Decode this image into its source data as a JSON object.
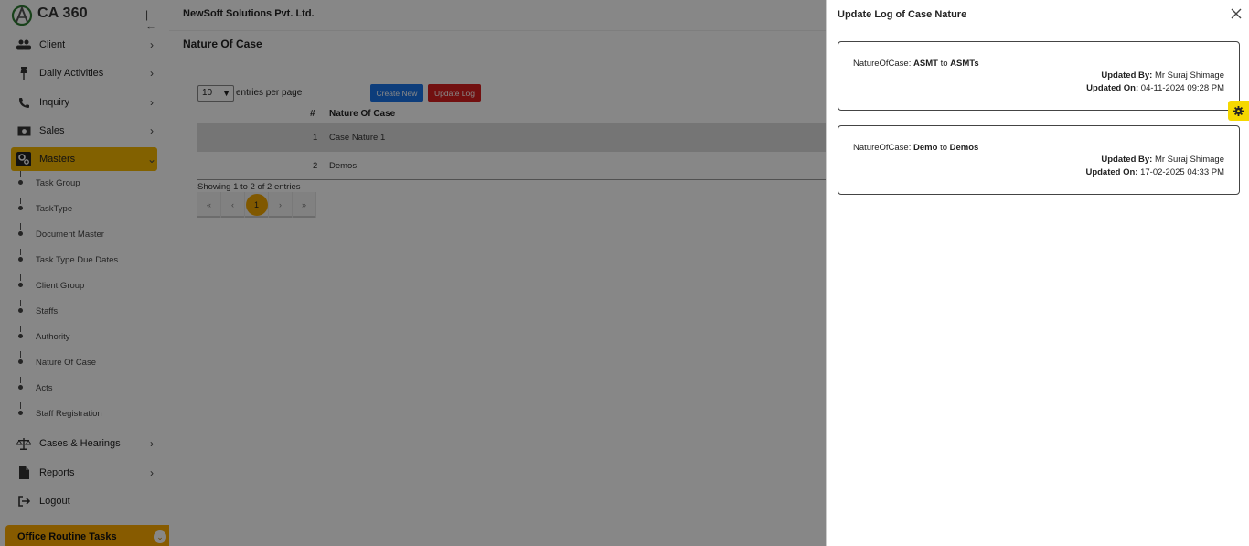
{
  "app": {
    "brand": "CA 360",
    "company": "NewSoft Solutions Pvt. Ltd."
  },
  "sidebar": {
    "items": [
      {
        "label": "Client",
        "icon": "users-icon"
      },
      {
        "label": "Daily Activities",
        "icon": "pin-icon"
      },
      {
        "label": "Inquiry",
        "icon": "phone-icon"
      },
      {
        "label": "Sales",
        "icon": "money-icon"
      },
      {
        "label": "Masters",
        "icon": "gears-icon"
      },
      {
        "label": "Cases & Hearings",
        "icon": "scales-icon"
      },
      {
        "label": "Reports",
        "icon": "file-icon"
      },
      {
        "label": "Logout",
        "icon": "logout-icon"
      }
    ],
    "masters_sub": [
      "Task Group",
      "TaskType",
      "Document Master",
      "Task Type Due Dates",
      "Client Group",
      "Staffs",
      "Authority",
      "Nature Of Case",
      "Acts",
      "Staff Registration"
    ],
    "office_routine": "Office Routine Tasks"
  },
  "page": {
    "title": "Nature Of Case",
    "entries_value": "10",
    "entries_label": "entries per page",
    "create_btn": "Create New",
    "update_log_btn": "Update Log",
    "columns": [
      "#",
      "Nature Of Case"
    ],
    "rows": [
      {
        "num": "1",
        "name": "Case Nature 1"
      },
      {
        "num": "2",
        "name": "Demos"
      }
    ],
    "showing": "Showing 1 to 2 of 2 entries",
    "pager": [
      "«",
      "‹",
      "1",
      "›",
      "»"
    ]
  },
  "drawer": {
    "title": "Update Log of Case Nature",
    "logs": [
      {
        "field": "NatureOfCase:",
        "from": "ASMT",
        "to_word": "to",
        "to": "ASMTs",
        "updated_by_label": "Updated By:",
        "updated_by": "Mr Suraj Shimage",
        "updated_on_label": "Updated On:",
        "updated_on": "04-11-2024 09:28 PM"
      },
      {
        "field": "NatureOfCase:",
        "from": "Demo",
        "to_word": "to",
        "to": "Demos",
        "updated_by_label": "Updated By:",
        "updated_by": "Mr Suraj Shimage",
        "updated_on_label": "Updated On:",
        "updated_on": "17-02-2025 04:33 PM"
      }
    ]
  },
  "colors": {
    "accent": "#f5b700",
    "office_bar": "#ffac00",
    "create_btn": "#1a73e8",
    "update_btn": "#d71f1f",
    "gear_tab": "#f5d800"
  }
}
